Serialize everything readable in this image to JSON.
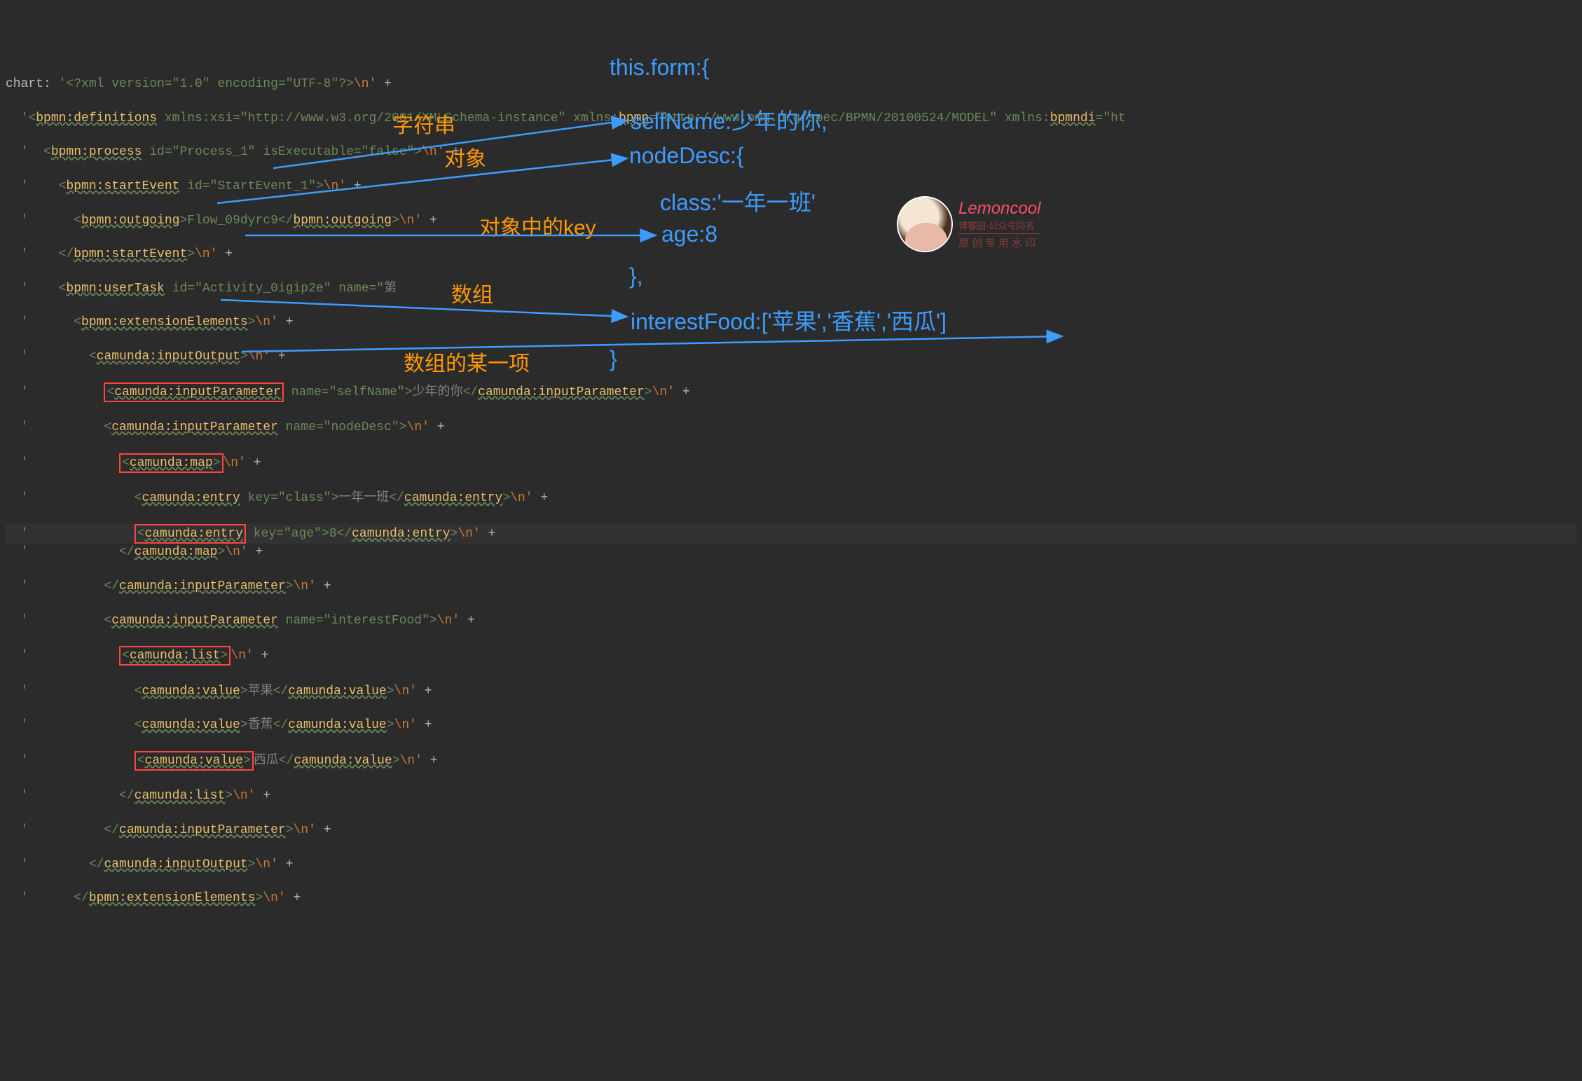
{
  "code": {
    "label": "chart:",
    "line1_pre": "'<?xml version=\"1.0\" encoding=\"UTF-8\"?>",
    "line2": "'<bpmn:definitions xmlns:xsi=\"http://www.w3.org/2001/XMLSchema-instance\" xmlns:bpmn=\"http://www.omg.org/spec/BPMN/20100524/MODEL\" xmlns:bpmndi=\"ht",
    "line3": "'  <bpmn:process id=\"Process_1\" isExecutable=\"false\">",
    "line4": "'    <bpmn:startEvent id=\"StartEvent_1\">",
    "line5": "'      <bpmn:outgoing>Flow_09dyrc9</bpmn:outgoing>",
    "line6": "'    </bpmn:startEvent>",
    "line7": "'    <bpmn:userTask id=\"Activity_0igip2e\" name=\"第",
    "line8": "'      <bpmn:extensionElements>",
    "line9": "'        <camunda:inputOutput>",
    "line10_tag": "<camunda:inputParameter",
    "line10_rest": " name=\"selfName\">少年的你</camunda:inputParameter>",
    "line11": "'          <camunda:inputParameter name=\"nodeDesc\">",
    "line12_tag": "<camunda:map>",
    "line13": "'              <camunda:entry key=\"class\">一年一班</camunda:entry>",
    "line14_tag": "<camunda:entry",
    "line14_rest": " key=\"age\">8</camunda:entry>",
    "line15": "'            </camunda:map>",
    "line16": "'          </camunda:inputParameter>",
    "line17": "'          <camunda:inputParameter name=\"interestFood\">",
    "line18_tag": "<camunda:list>",
    "line19": "'              <camunda:value>苹果</camunda:value>",
    "line20": "'              <camunda:value>香蕉</camunda:value>",
    "line21_tag": "<camunda:value>",
    "line21_rest": "西瓜</camunda:value>",
    "line22": "'            </camunda:list>",
    "line23": "'          </camunda:inputParameter>",
    "line24": "'        </camunda:inputOutput>",
    "line25": "'      </bpmn:extensionElements>",
    "nl": "\\n'",
    "plus": "+"
  },
  "annotations": {
    "orange": {
      "string": "字符串",
      "object": "对象",
      "objectKey": "对象中的key",
      "array": "数组",
      "arrayItem": "数组的某一项"
    },
    "blue": {
      "formHeader": "this.form:{",
      "selfName": "selfName:少年的你,",
      "nodeDesc": "nodeDesc:{",
      "classLine": "class:'一年一班'",
      "ageLine": "age:8",
      "closeNode": "},",
      "interestFood": "interestFood:['苹果','香蕉','西瓜']",
      "closeForm": "}"
    }
  },
  "watermark": {
    "title": "Lemoncool",
    "sub": "博客园·公众号同名",
    "foot": "原创专用水印"
  }
}
